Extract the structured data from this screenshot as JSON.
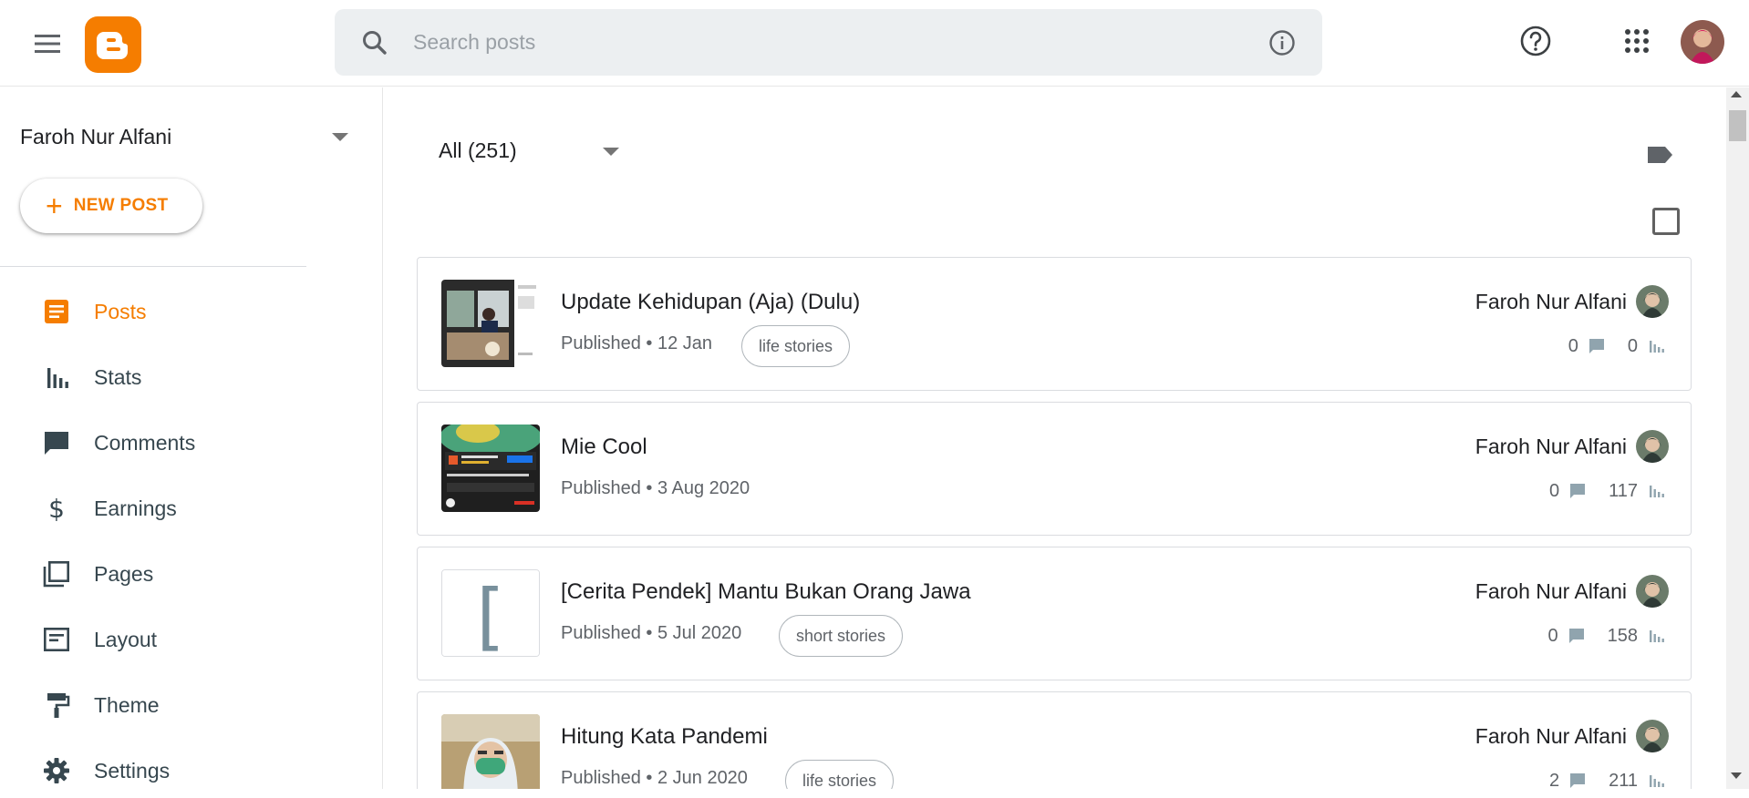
{
  "search": {
    "placeholder": "Search posts"
  },
  "sidebar": {
    "blog_name": "Faroh Nur Alfani",
    "new_post_label": "NEW POST",
    "items": [
      {
        "label": "Posts",
        "icon": "posts-icon",
        "active": true
      },
      {
        "label": "Stats",
        "icon": "stats-icon"
      },
      {
        "label": "Comments",
        "icon": "comments-icon"
      },
      {
        "label": "Earnings",
        "icon": "dollar-icon"
      },
      {
        "label": "Pages",
        "icon": "pages-icon"
      },
      {
        "label": "Layout",
        "icon": "layout-icon"
      },
      {
        "label": "Theme",
        "icon": "paint-roller-icon"
      },
      {
        "label": "Settings",
        "icon": "gear-icon"
      }
    ]
  },
  "main": {
    "filter_label": "All (251)",
    "posts": [
      {
        "title": "Update Kehidupan (Aja) (Dulu)",
        "status": "Published • 12 Jan",
        "label": "life stories",
        "author": "Faroh Nur Alfani",
        "comments": "0",
        "views": "0"
      },
      {
        "title": "Mie Cool",
        "status": "Published • 3 Aug 2020",
        "label": "",
        "author": "Faroh Nur Alfani",
        "comments": "0",
        "views": "117"
      },
      {
        "title": "[Cerita Pendek] Mantu Bukan Orang Jawa",
        "status": "Published • 5 Jul 2020",
        "label": "short stories",
        "author": "Faroh Nur Alfani",
        "comments": "0",
        "views": "158"
      },
      {
        "title": "Hitung Kata Pandemi",
        "status": "Published • 2 Jun 2020",
        "label": "life stories",
        "author": "Faroh Nur Alfani",
        "comments": "2",
        "views": "211"
      }
    ]
  },
  "colors": {
    "brand": "#f57d00",
    "icon": "#37474f",
    "search_bg": "#eceff1"
  }
}
